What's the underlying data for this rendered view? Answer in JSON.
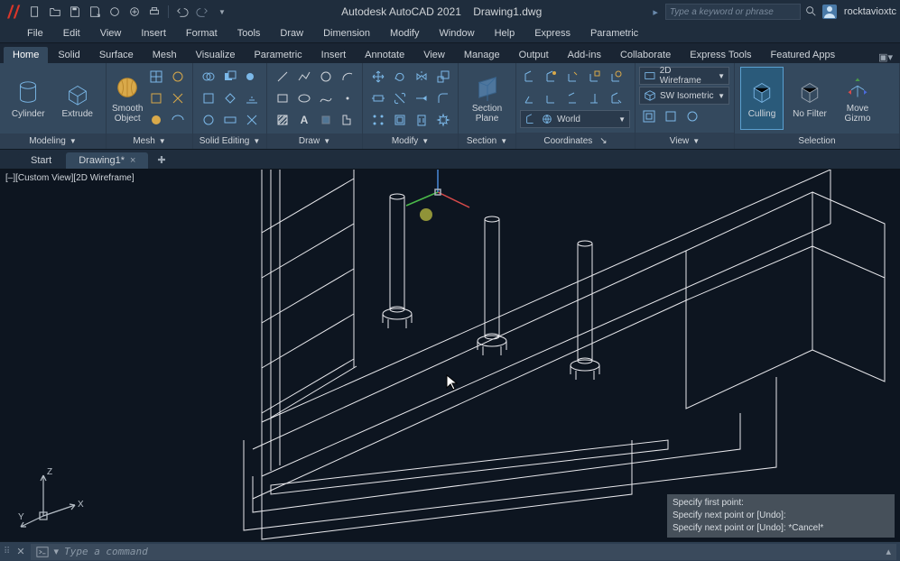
{
  "titlebar": {
    "app_title": "Autodesk AutoCAD 2021",
    "file_name": "Drawing1.dwg",
    "search_placeholder": "Type a keyword or phrase",
    "username": "rocktavioxtc"
  },
  "menubar": [
    "File",
    "Edit",
    "View",
    "Insert",
    "Format",
    "Tools",
    "Draw",
    "Dimension",
    "Modify",
    "Window",
    "Help",
    "Express",
    "Parametric"
  ],
  "ribbon_tabs": [
    "Home",
    "Solid",
    "Surface",
    "Mesh",
    "Visualize",
    "Parametric",
    "Insert",
    "Annotate",
    "View",
    "Manage",
    "Output",
    "Add-ins",
    "Collaborate",
    "Express Tools",
    "Featured Apps"
  ],
  "ribbon_active_tab": "Home",
  "ribbon": {
    "modeling": {
      "label": "Modeling",
      "cylinder": "Cylinder",
      "extrude": "Extrude",
      "smooth": "Smooth\nObject"
    },
    "mesh": {
      "label": "Mesh"
    },
    "solid_editing": {
      "label": "Solid Editing"
    },
    "draw": {
      "label": "Draw"
    },
    "modify": {
      "label": "Modify"
    },
    "section": {
      "label": "Section",
      "plane": "Section\nPlane"
    },
    "coordinates": {
      "label": "Coordinates",
      "world": "World"
    },
    "view": {
      "label": "View",
      "style": "2D Wireframe",
      "iso": "SW Isometric"
    },
    "selection": {
      "label": "Selection",
      "culling": "Culling",
      "nofilter": "No Filter",
      "gizmo": "Move\nGizmo"
    }
  },
  "doctabs": {
    "start": "Start",
    "drawing": "Drawing1*"
  },
  "viewport": {
    "label": "[–][Custom View][2D Wireframe]",
    "ucs": {
      "x": "X",
      "y": "Y",
      "z": "Z"
    }
  },
  "cmd_history": [
    "Specify first point:",
    "Specify next point or [Undo]:",
    "Specify next point or [Undo]: *Cancel*"
  ],
  "cmdbar": {
    "placeholder": "Type a command"
  }
}
